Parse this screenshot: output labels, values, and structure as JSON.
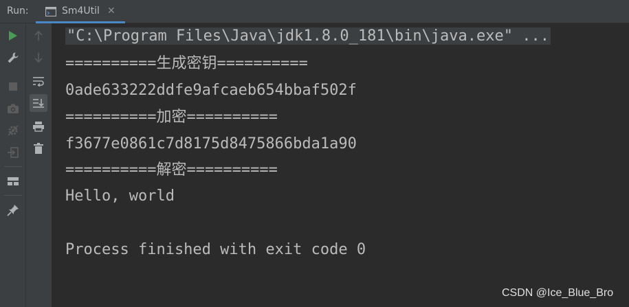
{
  "run_panel": {
    "label": "Run:",
    "tab": {
      "title": "Sm4Util",
      "close_glyph": "✕"
    }
  },
  "toolbar": {
    "primary": [
      {
        "name": "rerun-icon",
        "color": "#499c54"
      },
      {
        "name": "wrench-icon",
        "color": "#afb1b3"
      },
      {
        "name": "stop-icon",
        "color": "#5c5c5c"
      },
      {
        "name": "camera-icon",
        "color": "#5c5c5c"
      },
      {
        "name": "settings-gear-icon",
        "color": "#5c5c5c"
      },
      {
        "name": "exit-icon",
        "color": "#5c5c5c"
      },
      {
        "name": "layout-icon",
        "color": "#afb1b3"
      },
      {
        "name": "pin-icon",
        "color": "#afb1b3"
      }
    ],
    "secondary": [
      {
        "name": "arrow-up-icon",
        "color": "#5c5c5c"
      },
      {
        "name": "arrow-down-icon",
        "color": "#5c5c5c"
      },
      {
        "name": "soft-wrap-icon",
        "color": "#afb1b3"
      },
      {
        "name": "scroll-to-end-icon",
        "color": "#afb1b3"
      },
      {
        "name": "print-icon",
        "color": "#afb1b3"
      },
      {
        "name": "trash-icon",
        "color": "#afb1b3"
      }
    ]
  },
  "console": {
    "lines": [
      "\"C:\\Program Files\\Java\\jdk1.8.0_181\\bin\\java.exe\" ...",
      "==========生成密钥==========",
      "0ade633222ddfe9afcaeb654bbaf502f",
      "==========加密==========",
      "f3677e0861c7d8175d8475866bda1a90",
      "==========解密==========",
      "Hello, world",
      "",
      "Process finished with exit code 0"
    ]
  },
  "watermark": "CSDN @Ice_Blue_Bro",
  "colors": {
    "background": "#2b2b2b",
    "panel": "#3c3f41",
    "text": "#bbbbbb",
    "accent": "#4a88c7",
    "run_green": "#499c54"
  }
}
